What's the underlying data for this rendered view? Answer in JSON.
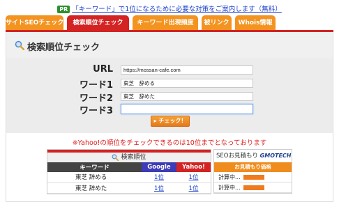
{
  "promo": {
    "badge": "PR",
    "link_text": "「キーワード」で1位になるために必要な対策をご案内します（無料）"
  },
  "tabs": [
    {
      "label": "サイトSEOチェック",
      "active": false
    },
    {
      "label": "検索順位チェック",
      "active": true
    },
    {
      "label": "キーワード出現頻度",
      "active": false
    },
    {
      "label": "被リンク",
      "active": false
    },
    {
      "label": "Whois情報",
      "active": false
    }
  ],
  "panel": {
    "title": "検索順位チェック",
    "icon": "magnifier-icon"
  },
  "form": {
    "url_label": "URL",
    "url_value": "https://mossan-cafe.com",
    "word1_label": "ワード1",
    "word1_value": "東芝　辞める",
    "word2_label": "ワード2",
    "word2_value": "東芝　辞めた",
    "word3_label": "ワード3",
    "word3_value": "",
    "check_button": "▸ チェック！"
  },
  "notice": "※Yahoo!の順位をチェックできるのは10位までとなっております",
  "results": {
    "title": "検索順位",
    "headers": {
      "keyword": "キーワード",
      "google": "Google",
      "yahoo": "Yahoo!"
    },
    "rows": [
      {
        "keyword": "東芝 辞める",
        "google": "1位",
        "yahoo": "1位"
      },
      {
        "keyword": "東芝 辞めた",
        "google": "1位",
        "yahoo": "1位"
      }
    ]
  },
  "seo_estimate": {
    "title": "SEOお見積もり",
    "brand": "GMOTECH",
    "subheader": "お見積もり価格",
    "rows": [
      "計算中...",
      "計算中..."
    ]
  },
  "colors": {
    "accent_red": "#d32323",
    "tab_orange": "#f39320",
    "google_blue": "#3d3bb5",
    "link_blue": "#1a3fcc",
    "notice_red": "#e02020"
  }
}
